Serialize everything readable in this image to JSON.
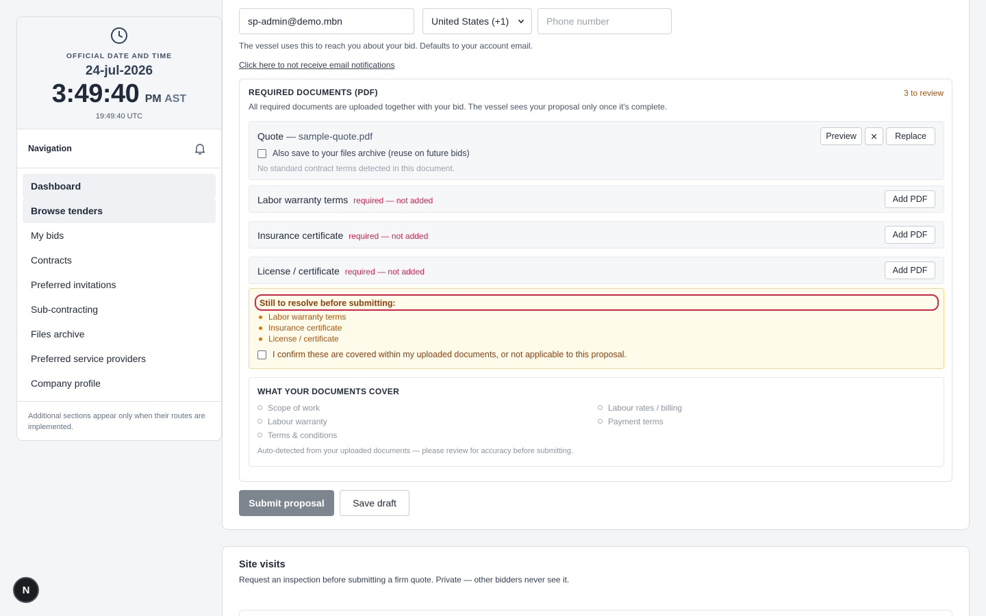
{
  "sidebar": {
    "clock": {
      "caption": "OFFICIAL DATE AND TIME",
      "date": "24-jul-2026",
      "time": "3:49:40",
      "ampm": "PM",
      "timezone": "AST",
      "utc": "19:49:40 UTC"
    },
    "nav_title": "Navigation",
    "items": [
      {
        "label": "Dashboard"
      },
      {
        "label": "Browse tenders"
      },
      {
        "label": "My bids"
      },
      {
        "label": "Contracts"
      },
      {
        "label": "Preferred invitations"
      },
      {
        "label": "Sub-contracting"
      },
      {
        "label": "Files archive"
      },
      {
        "label": "Preferred service providers"
      },
      {
        "label": "Company profile"
      }
    ],
    "footer_note": "Additional sections appear only when their routes are implemented."
  },
  "contact": {
    "email_value": "sp-admin@demo.mbn",
    "country_selected": "United States (+1)",
    "phone_placeholder": "Phone number",
    "hint": "The vessel uses this to reach you about your bid. Defaults to your account email.",
    "no_email_link": "Click here to not receive email notifications"
  },
  "documents": {
    "title": "REQUIRED DOCUMENTS (PDF)",
    "count": "3 to review",
    "subtitle": "All required documents are uploaded together with your bid. The vessel sees your proposal only once it's complete.",
    "quote": {
      "name": "Quote",
      "file": " — sample-quote.pdf",
      "preview_label": "Preview",
      "remove_label": "✕",
      "replace_label": "Replace",
      "archive_label": "Also save to your files archive (reuse on future bids)",
      "note": "No standard contract terms detected in this document."
    },
    "rows": [
      {
        "name": "Labor warranty terms",
        "status": "required — not added",
        "button": "Add PDF"
      },
      {
        "name": "Insurance certificate",
        "status": "required — not added",
        "button": "Add PDF"
      },
      {
        "name": "License / certificate",
        "status": "required — not added",
        "button": "Add PDF"
      }
    ],
    "warning": {
      "title": "Still to resolve before submitting:",
      "items": [
        "Labor warranty terms",
        "Insurance certificate",
        "License / certificate"
      ],
      "confirm": "I confirm these are covered within my uploaded documents, or not applicable to this proposal."
    },
    "cover": {
      "title": "WHAT YOUR DOCUMENTS COVER",
      "left": [
        "Scope of work",
        "Labour warranty",
        "Terms & conditions"
      ],
      "right": [
        "Labour rates / billing",
        "Payment terms"
      ],
      "note": "Auto-detected from your uploaded documents — please review for accuracy before submitting."
    }
  },
  "actions": {
    "submit": "Submit proposal",
    "draft": "Save draft"
  },
  "site_visits": {
    "title": "Site visits",
    "subtitle": "Request an inspection before submitting a firm quote. Private — other bidders never see it."
  },
  "fab_label": "N"
}
